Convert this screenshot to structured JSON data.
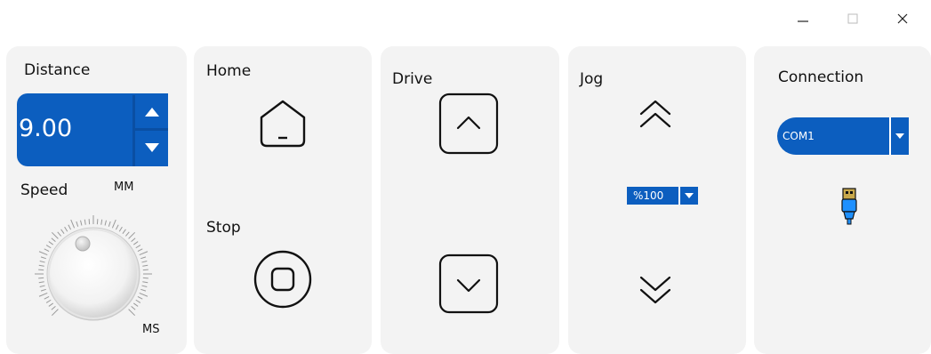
{
  "window": {
    "minimize_icon": "minimize-icon",
    "maximize_icon": "maximize-icon",
    "close_icon": "close-icon"
  },
  "distance": {
    "label": "Distance",
    "value": "9.00",
    "unit": "MM",
    "up_icon": "triangle-up-icon",
    "down_icon": "triangle-down-icon"
  },
  "speed": {
    "label": "Speed",
    "unit": "MS",
    "knob_icon": "speed-knob-icon"
  },
  "home": {
    "label": "Home",
    "icon": "home-icon"
  },
  "stop": {
    "label": "Stop",
    "icon": "stop-icon"
  },
  "drive": {
    "label": "Drive",
    "up_icon": "chevron-up-icon",
    "down_icon": "chevron-down-icon"
  },
  "jog": {
    "label": "Jog",
    "up_icon": "double-chevron-up-icon",
    "down_icon": "double-chevron-down-icon",
    "speed_value": "%100",
    "dropdown_icon": "triangle-down-icon"
  },
  "connection": {
    "label": "Connection",
    "port_value": "COM1",
    "dropdown_icon": "triangle-down-icon",
    "usb_icon": "usb-plug-icon"
  },
  "colors": {
    "accent": "#0c5ebf",
    "panel_bg": "#f3f3f3",
    "usb_blue": "#1e90ff",
    "usb_tip": "#c8a84b"
  }
}
